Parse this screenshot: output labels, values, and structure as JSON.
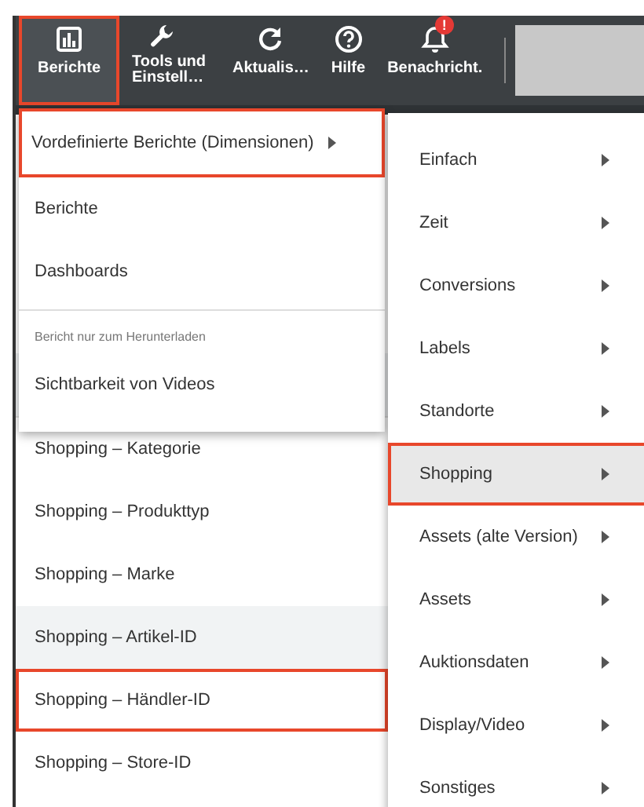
{
  "toolbar": {
    "items": [
      {
        "label": "Berichte",
        "kind": "chart",
        "selected": true,
        "highlighted": true
      },
      {
        "label": "Tools und Einstell…",
        "kind": "wrench",
        "selected": false,
        "highlighted": false
      },
      {
        "label": "Aktualis…",
        "kind": "refresh",
        "selected": false,
        "highlighted": false
      },
      {
        "label": "Hilfe",
        "kind": "help",
        "selected": false,
        "highlighted": false
      },
      {
        "label": "Benachricht.",
        "kind": "bell",
        "badge": "!",
        "selected": false,
        "highlighted": false
      }
    ]
  },
  "list": {
    "rows": [
      {
        "label": "Shopping – Kategorie",
        "selected": false,
        "highlighted": false
      },
      {
        "label": "Shopping – Produkttyp",
        "selected": false,
        "highlighted": false
      },
      {
        "label": "Shopping – Marke",
        "selected": false,
        "highlighted": false
      },
      {
        "label": "Shopping – Artikel-ID",
        "selected": true,
        "highlighted": false
      },
      {
        "label": "Shopping – Händler-ID",
        "selected": false,
        "highlighted": true
      },
      {
        "label": "Shopping – Store-ID",
        "selected": false,
        "highlighted": false
      }
    ]
  },
  "menu": {
    "items": [
      {
        "kind": "item",
        "label": "Vordefinierte Berichte (Dimensionen)",
        "submenu": true,
        "highlighted": true
      },
      {
        "kind": "item",
        "label": "Berichte",
        "submenu": false,
        "highlighted": false
      },
      {
        "kind": "item",
        "label": "Dashboards",
        "submenu": false,
        "highlighted": false
      },
      {
        "kind": "heading",
        "label": "Bericht nur zum Herunterladen"
      },
      {
        "kind": "item",
        "label": "Sichtbarkeit von Videos",
        "submenu": false,
        "highlighted": false
      }
    ]
  },
  "submenu": {
    "items": [
      {
        "label": "Einfach",
        "selected": false,
        "highlighted": false
      },
      {
        "label": "Zeit",
        "selected": false,
        "highlighted": false
      },
      {
        "label": "Conversions",
        "selected": false,
        "highlighted": false
      },
      {
        "label": "Labels",
        "selected": false,
        "highlighted": false
      },
      {
        "label": "Standorte",
        "selected": false,
        "highlighted": false
      },
      {
        "label": "Shopping",
        "selected": true,
        "highlighted": true
      },
      {
        "label": "Assets (alte Version)",
        "selected": false,
        "highlighted": false
      },
      {
        "label": "Assets",
        "selected": false,
        "highlighted": false
      },
      {
        "label": "Auktionsdaten",
        "selected": false,
        "highlighted": false
      },
      {
        "label": "Display/Video",
        "selected": false,
        "highlighted": false
      },
      {
        "label": "Sonstiges",
        "selected": false,
        "highlighted": false
      }
    ]
  }
}
